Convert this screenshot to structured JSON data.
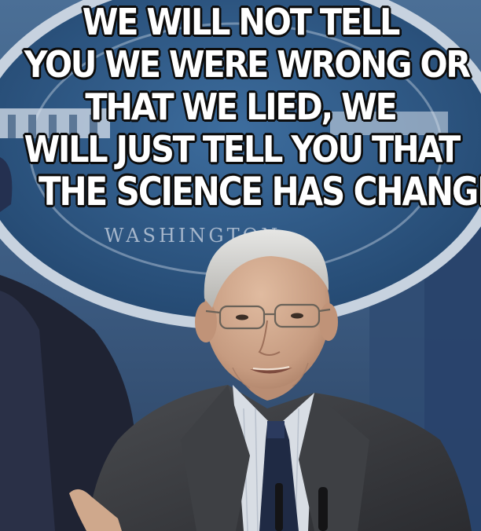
{
  "meme": {
    "caption_lines": [
      "WE WILL NOT TELL",
      "YOU WE WERE WRONG OR",
      "THAT WE LIED, WE",
      "WILL JUST TELL YOU THAT",
      "THE SCIENCE HAS CHANGED."
    ]
  },
  "backdrop": {
    "seal_text": "WASHINGTON"
  },
  "colors": {
    "wall": "#3c5f86",
    "seal_blue": "#2f5a87",
    "seal_ring": "#c7d2df",
    "suit": "#3a3c40",
    "tie": "#1f2a44",
    "skin": "#c9a58a"
  }
}
